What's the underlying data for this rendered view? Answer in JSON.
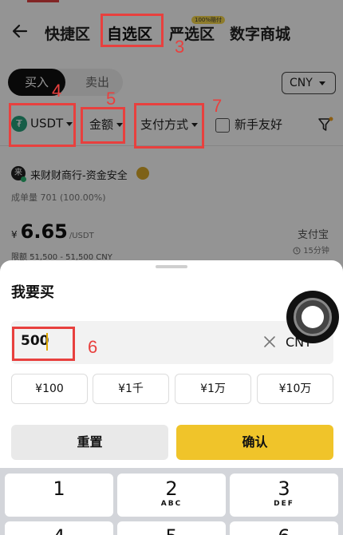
{
  "header": {
    "tabs": [
      {
        "label": "快捷区"
      },
      {
        "label": "自选区"
      },
      {
        "label": "严选区"
      },
      {
        "label": "数字商城"
      }
    ],
    "strict_badge": "100%赔付"
  },
  "trade_toggle": {
    "buy": "买入",
    "sell": "卖出"
  },
  "currency_select": "CNY",
  "filters": {
    "coin": "USDT",
    "amount": "金额",
    "payment": "支付方式",
    "newbie_checkbox": "新手友好"
  },
  "listing": {
    "avatar_char": "来",
    "merchant_name": "来财财商行-资金安全",
    "stats": "成单量 701 (100.00%)",
    "currency_symbol": "¥",
    "price": "6.65",
    "price_unit": "/USDT",
    "limits": "限额 51,500 - 51,500 CNY",
    "payment_method": "支付宝",
    "time_limit": "15分钟"
  },
  "sheet": {
    "title": "我要买",
    "amount_value": "500",
    "amount_currency": "CNY",
    "quick_amounts": [
      "¥100",
      "¥1千",
      "¥1万",
      "¥10万"
    ],
    "reset_label": "重置",
    "confirm_label": "确认"
  },
  "keypad": {
    "row1": [
      {
        "num": "1",
        "sub": ""
      },
      {
        "num": "2",
        "sub": "ABC"
      },
      {
        "num": "3",
        "sub": "DEF"
      }
    ],
    "row2": [
      {
        "num": "4"
      },
      {
        "num": "5"
      },
      {
        "num": "6"
      }
    ]
  },
  "annotations": [
    "3",
    "4",
    "5",
    "6",
    "7"
  ],
  "colors": {
    "annotation_red": "#e8403e",
    "confirm_yellow": "#f0c42a",
    "usdt_green": "#26a17b"
  }
}
